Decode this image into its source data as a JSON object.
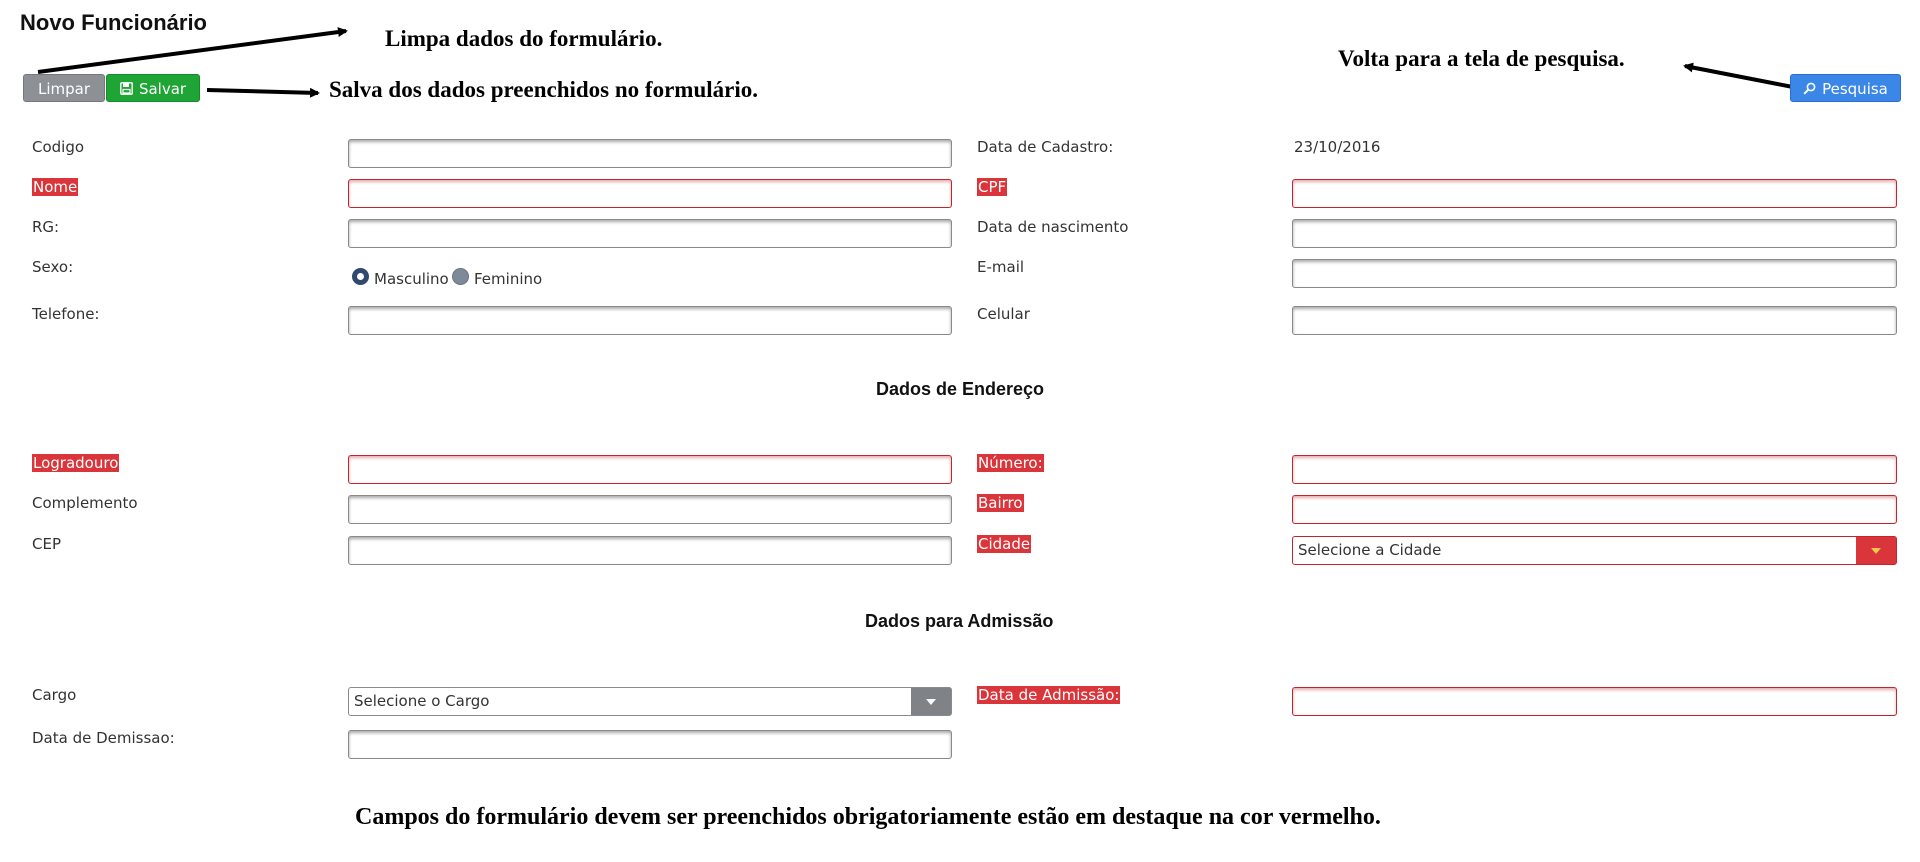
{
  "page": {
    "title": "Novo Funcionário"
  },
  "annotations": {
    "limpar": "Limpa dados do formulário.",
    "salvar": "Salva dos dados preenchidos no formulário.",
    "pesquisa": "Volta para a tela de pesquisa.",
    "footer": "Campos do formulário devem ser preenchidos obrigatoriamente estão em destaque na cor vermelho."
  },
  "toolbar": {
    "limpar_label": "Limpar",
    "salvar_label": "Salvar",
    "pesquisa_label": "Pesquisa"
  },
  "colors": {
    "required": "#d9353a",
    "save": "#1ea535",
    "search": "#3b87e8",
    "clear": "#8d9195"
  },
  "form": {
    "codigo": {
      "label": "Codigo",
      "value": ""
    },
    "data_cadastro": {
      "label": "Data de Cadastro:",
      "value": "23/10/2016"
    },
    "nome": {
      "label": "Nome",
      "value": "",
      "required": true
    },
    "cpf": {
      "label": "CPF",
      "value": "",
      "required": true
    },
    "rg": {
      "label": "RG:",
      "value": ""
    },
    "data_nascimento": {
      "label": "Data de nascimento",
      "value": ""
    },
    "sexo": {
      "label": "Sexo:",
      "options": [
        "Masculino",
        "Feminino"
      ],
      "selected": "Masculino"
    },
    "email": {
      "label": "E-mail",
      "value": ""
    },
    "telefone": {
      "label": "Telefone:",
      "value": ""
    },
    "celular": {
      "label": "Celular",
      "value": ""
    }
  },
  "endereco": {
    "title": "Dados de Endereço",
    "logradouro": {
      "label": "Logradouro",
      "value": "",
      "required": true
    },
    "numero": {
      "label": "Número:",
      "value": "",
      "required": true
    },
    "complemento": {
      "label": "Complemento",
      "value": ""
    },
    "bairro": {
      "label": "Bairro",
      "value": "",
      "required": true
    },
    "cep": {
      "label": "CEP",
      "value": ""
    },
    "cidade": {
      "label": "Cidade",
      "selected": "Selecione a Cidade",
      "required": true
    }
  },
  "admissao": {
    "title": "Dados para Admissão",
    "cargo": {
      "label": "Cargo",
      "selected": "Selecione o Cargo"
    },
    "data_admissao": {
      "label": "Data de Admissão:",
      "value": "",
      "required": true
    },
    "data_demissao": {
      "label": "Data de Demissao:",
      "value": ""
    }
  }
}
